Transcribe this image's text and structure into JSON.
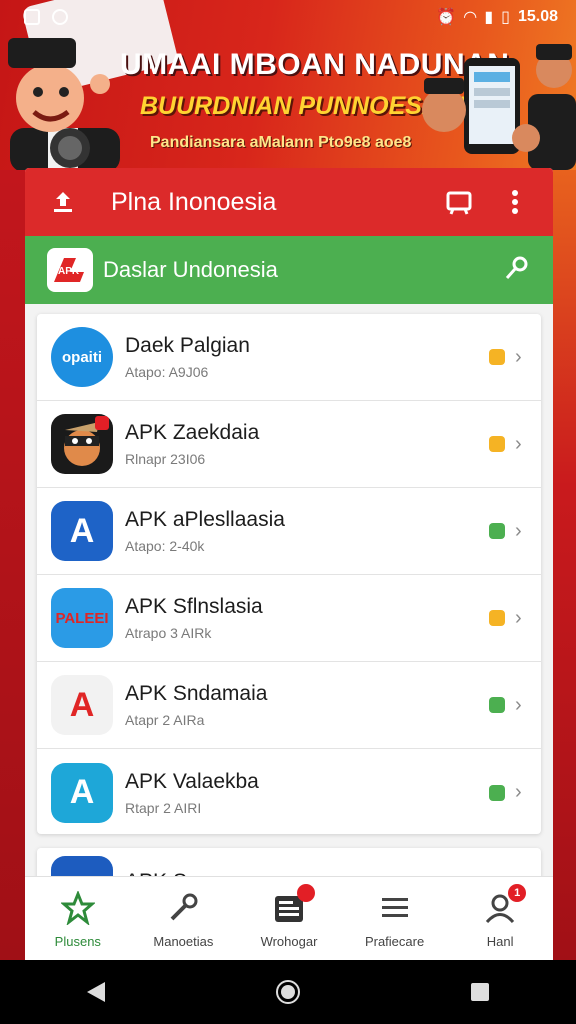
{
  "status_bar": {
    "time": "15.08"
  },
  "banner": {
    "title": "UMAAI MBOAN NADUNAN",
    "subtitle": "BUURDNIAN PUNNOESADIS",
    "tagline": "Pandiansara aMalann Pto9e8 aoe8"
  },
  "app_bar": {
    "title": "Plna Inonoesia"
  },
  "category_bar": {
    "logo_text": "APK",
    "label": "Daslar Undonesia"
  },
  "apps": [
    {
      "name": "Daek Palgian",
      "size": "Atapo: A9J06",
      "status": "pending",
      "icon": "opaiti-icon",
      "icon_text": "opaiti"
    },
    {
      "name": "APK Zaekdaia",
      "size": "Rlnapr 23I06",
      "status": "pending",
      "icon": "bandit-character-icon",
      "icon_text": ""
    },
    {
      "name": "APK aPlesllaasia",
      "size": "Atapo: 2-40k",
      "status": "installed",
      "icon": "letter-a-blue-icon",
      "icon_text": "A"
    },
    {
      "name": "APK Sflnslasia",
      "size": "Atrapo 3 AIRk",
      "status": "pending",
      "icon": "palei-icon",
      "icon_text": "PALEEI"
    },
    {
      "name": "APK Sndamaia",
      "size": "Atapr 2 AIRa",
      "status": "installed",
      "icon": "letter-a-red-icon",
      "icon_text": "A"
    },
    {
      "name": "APK Valaekba",
      "size": "Rtapr 2 AIRI",
      "status": "installed",
      "icon": "letter-a-teal-icon",
      "icon_text": "A"
    }
  ],
  "partial_app": {
    "name": "APK S..."
  },
  "bottom_nav": [
    {
      "label": "Plusens",
      "icon": "star-icon",
      "active": true
    },
    {
      "label": "Manoetias",
      "icon": "wrench-icon",
      "active": false
    },
    {
      "label": "Wrohogar",
      "icon": "news-icon",
      "active": false,
      "badge": true
    },
    {
      "label": "Prafiecare",
      "icon": "list-icon",
      "active": false
    },
    {
      "label": "Hanl",
      "icon": "user-icon",
      "active": false,
      "badge_text": "1"
    }
  ],
  "colors": {
    "app_bar": "#dc2a2a",
    "category_bar": "#4caf50",
    "status_pending": "#f5b324",
    "status_installed": "#4caf50"
  }
}
